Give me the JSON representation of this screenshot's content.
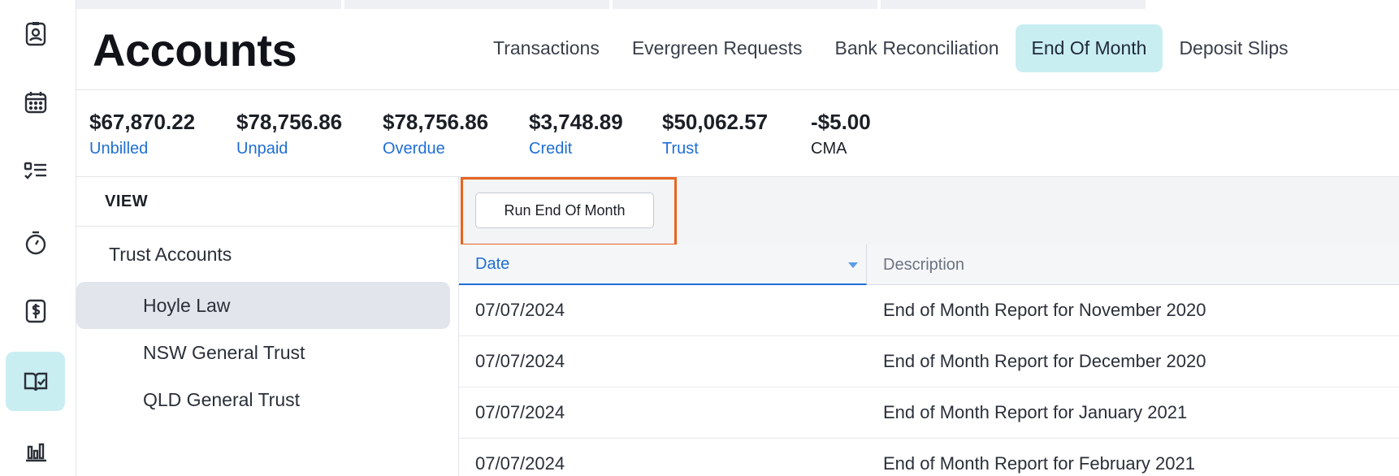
{
  "rail": [
    {
      "icon": "contact-card-icon",
      "active": false
    },
    {
      "icon": "calendar-icon",
      "active": false
    },
    {
      "icon": "checklist-icon",
      "active": false
    },
    {
      "icon": "stopwatch-icon",
      "active": false
    },
    {
      "icon": "billing-dollar-icon",
      "active": false
    },
    {
      "icon": "accounts-book-icon",
      "active": true
    },
    {
      "icon": "bar-chart-icon",
      "active": false
    }
  ],
  "header": {
    "title": "Accounts",
    "tabs": [
      {
        "label": "Transactions"
      },
      {
        "label": "Evergreen Requests"
      },
      {
        "label": "Bank Reconciliation"
      },
      {
        "label": "End Of Month",
        "active": true
      },
      {
        "label": "Deposit Slips"
      }
    ]
  },
  "stats": [
    {
      "value": "$67,870.22",
      "label": "Unbilled"
    },
    {
      "value": "$78,756.86",
      "label": "Unpaid"
    },
    {
      "value": "$78,756.86",
      "label": "Overdue"
    },
    {
      "value": "$3,748.89",
      "label": "Credit"
    },
    {
      "value": "$50,062.57",
      "label": "Trust"
    },
    {
      "value": "-$5.00",
      "label": "CMA"
    }
  ],
  "view": {
    "heading": "VIEW",
    "group": "Trust Accounts",
    "items": [
      "Hoyle Law",
      "NSW General Trust",
      "QLD General Trust"
    ],
    "selected": "Hoyle Law"
  },
  "toolbar": {
    "run_label": "Run End Of Month"
  },
  "table": {
    "columns": [
      "Date",
      "Description"
    ],
    "rows": [
      {
        "date": "07/07/2024",
        "description": "End of Month Report for November 2020"
      },
      {
        "date": "07/07/2024",
        "description": "End of Month Report for December 2020"
      },
      {
        "date": "07/07/2024",
        "description": "End of Month Report for January 2021"
      },
      {
        "date": "07/07/2024",
        "description": "End of Month Report for February 2021"
      }
    ]
  },
  "colors": {
    "accent_bg": "#c9eef2",
    "link_blue": "#1f6ed4",
    "focus_outline": "#e8641f"
  }
}
